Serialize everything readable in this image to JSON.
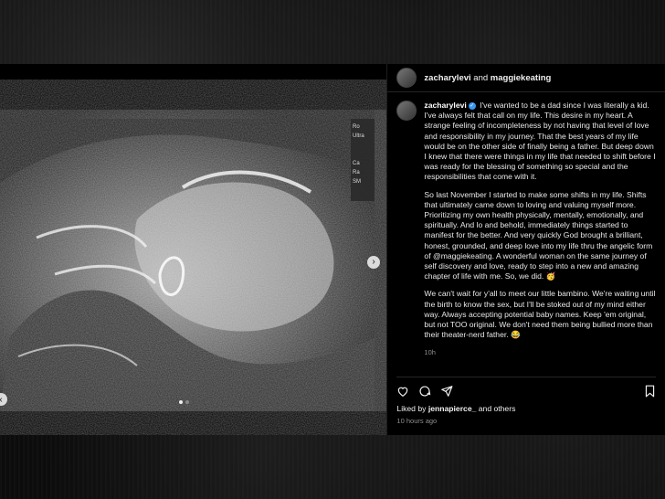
{
  "header": {
    "user1": "zacharylevi",
    "joiner": " and ",
    "user2": "maggiekeating"
  },
  "caption": {
    "username": "zacharylevi",
    "verified_icon": "verified-badge-icon",
    "paragraph1": "I've wanted to be a dad since I was literally a kid. I've always felt that call on my life. This desire in my heart. A strange feeling of incompleteness by not having that level of love and responsibility in my journey. That the best years of my life would be on the other side of finally being a father. But deep down I knew that there were things in my life that needed to shift before I was ready for the blessing of something so special and the responsibilities that come with it.",
    "paragraph2": "So last November I started to make some shifts in my life. Shifts that ultimately came down to loving and valuing myself more. Prioritizing my own health physically, mentally, emotionally, and spiritually. And lo and behold, immediately things started to manifest for the better. And very quickly God brought a brilliant, honest, grounded, and deep love into my life thru the angelic form of @maggiekeating. A wonderful woman on the same journey of self discovery and love, ready to step into a new and amazing chapter of life with me. So, we did. 🥳",
    "paragraph3": "We can't wait for y'all to meet our little bambino. We're waiting until the birth to know the sex, but I'll be stoked out of my mind either way. Always accepting potential baby names. Keep 'em original, but not TOO original. We don't need them being bullied more than their theater-nerd father. 😂",
    "age": "10h"
  },
  "likes": {
    "prefix": "Liked by ",
    "user": "jennapierce_",
    "suffix": " and others"
  },
  "posted": "10 hours ago",
  "ultrasound_labels": {
    "l1": "Ro",
    "l2": "Ultra",
    "l3": "Ca",
    "l4": "Ra",
    "l5": "SM"
  },
  "icons": {
    "like": "heart-icon",
    "comment": "comment-icon",
    "share": "send-icon",
    "save": "bookmark-icon",
    "next": "chevron-right-icon",
    "prev": "chevron-left-icon"
  },
  "colors": {
    "verified": "#3897f0",
    "panel_bg": "#000000",
    "muted_text": "#8e8e8e"
  }
}
